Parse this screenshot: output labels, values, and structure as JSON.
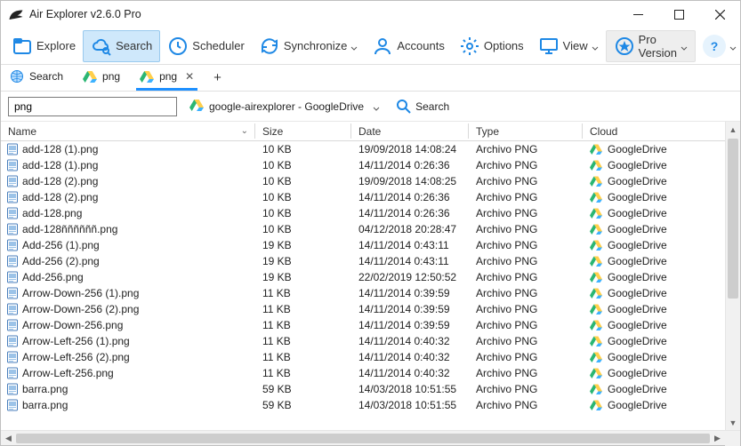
{
  "title": "Air Explorer v2.6.0 Pro",
  "toolbar": {
    "explore": "Explore",
    "search": "Search",
    "scheduler": "Scheduler",
    "synchronize": "Synchronize",
    "accounts": "Accounts",
    "options": "Options",
    "view": "View",
    "pro": "Pro Version"
  },
  "tabs": [
    {
      "label": "Search"
    },
    {
      "label": "png"
    },
    {
      "label": "png"
    }
  ],
  "search": {
    "value": "png",
    "location": "google-airexplorer - GoogleDrive",
    "button": "Search"
  },
  "columns": {
    "name": "Name",
    "size": "Size",
    "date": "Date",
    "type": "Type",
    "cloud": "Cloud"
  },
  "files": [
    {
      "name": "add-128 (1).png",
      "size": "10 KB",
      "date": "19/09/2018 14:08:24",
      "type": "Archivo PNG",
      "cloud": "GoogleDrive"
    },
    {
      "name": "add-128 (1).png",
      "size": "10 KB",
      "date": "14/11/2014 0:26:36",
      "type": "Archivo PNG",
      "cloud": "GoogleDrive"
    },
    {
      "name": "add-128 (2).png",
      "size": "10 KB",
      "date": "19/09/2018 14:08:25",
      "type": "Archivo PNG",
      "cloud": "GoogleDrive"
    },
    {
      "name": "add-128 (2).png",
      "size": "10 KB",
      "date": "14/11/2014 0:26:36",
      "type": "Archivo PNG",
      "cloud": "GoogleDrive"
    },
    {
      "name": "add-128.png",
      "size": "10 KB",
      "date": "14/11/2014 0:26:36",
      "type": "Archivo PNG",
      "cloud": "GoogleDrive"
    },
    {
      "name": "add-128ññññññ.png",
      "size": "10 KB",
      "date": "04/12/2018 20:28:47",
      "type": "Archivo PNG",
      "cloud": "GoogleDrive"
    },
    {
      "name": "Add-256 (1).png",
      "size": "19 KB",
      "date": "14/11/2014 0:43:11",
      "type": "Archivo PNG",
      "cloud": "GoogleDrive"
    },
    {
      "name": "Add-256 (2).png",
      "size": "19 KB",
      "date": "14/11/2014 0:43:11",
      "type": "Archivo PNG",
      "cloud": "GoogleDrive"
    },
    {
      "name": "Add-256.png",
      "size": "19 KB",
      "date": "22/02/2019 12:50:52",
      "type": "Archivo PNG",
      "cloud": "GoogleDrive"
    },
    {
      "name": "Arrow-Down-256 (1).png",
      "size": "11 KB",
      "date": "14/11/2014 0:39:59",
      "type": "Archivo PNG",
      "cloud": "GoogleDrive"
    },
    {
      "name": "Arrow-Down-256 (2).png",
      "size": "11 KB",
      "date": "14/11/2014 0:39:59",
      "type": "Archivo PNG",
      "cloud": "GoogleDrive"
    },
    {
      "name": "Arrow-Down-256.png",
      "size": "11 KB",
      "date": "14/11/2014 0:39:59",
      "type": "Archivo PNG",
      "cloud": "GoogleDrive"
    },
    {
      "name": "Arrow-Left-256 (1).png",
      "size": "11 KB",
      "date": "14/11/2014 0:40:32",
      "type": "Archivo PNG",
      "cloud": "GoogleDrive"
    },
    {
      "name": "Arrow-Left-256 (2).png",
      "size": "11 KB",
      "date": "14/11/2014 0:40:32",
      "type": "Archivo PNG",
      "cloud": "GoogleDrive"
    },
    {
      "name": "Arrow-Left-256.png",
      "size": "11 KB",
      "date": "14/11/2014 0:40:32",
      "type": "Archivo PNG",
      "cloud": "GoogleDrive"
    },
    {
      "name": "barra.png",
      "size": "59 KB",
      "date": "14/03/2018 10:51:55",
      "type": "Archivo PNG",
      "cloud": "GoogleDrive"
    },
    {
      "name": "barra.png",
      "size": "59 KB",
      "date": "14/03/2018 10:51:55",
      "type": "Archivo PNG",
      "cloud": "GoogleDrive"
    }
  ]
}
